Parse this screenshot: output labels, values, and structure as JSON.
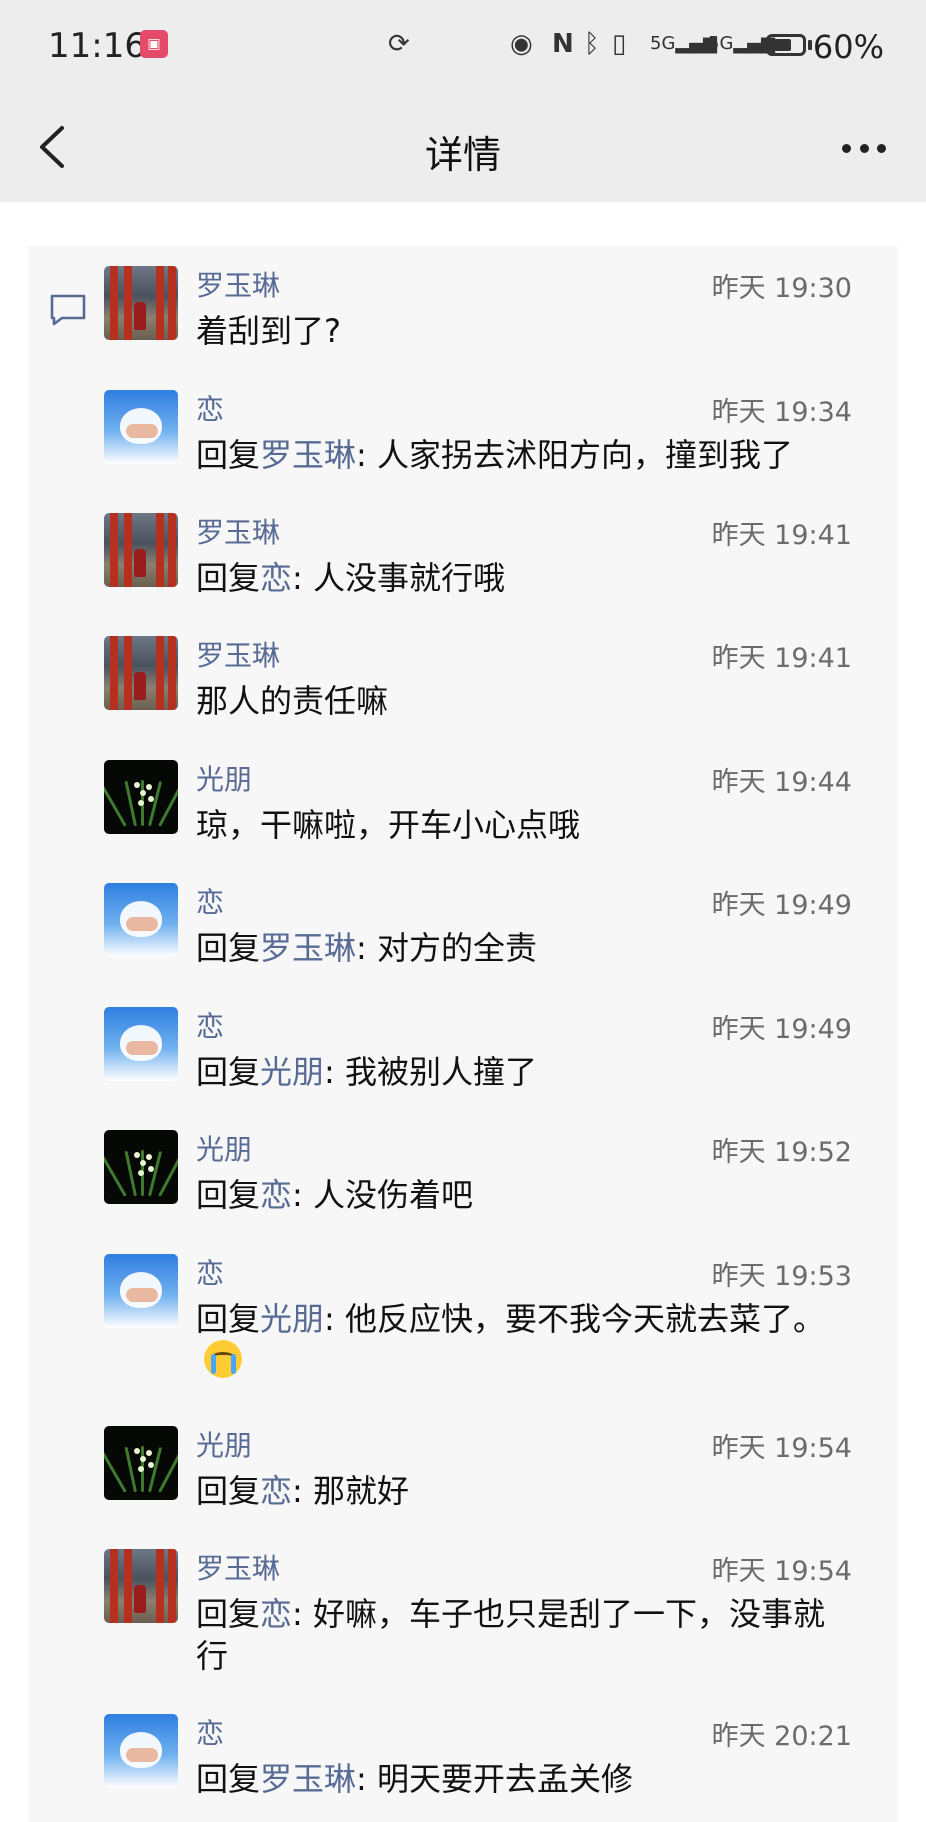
{
  "status_bar": {
    "time": "11:16",
    "battery": "60%",
    "icons": [
      "app-badge-icon",
      "sync-icon",
      "eye-icon",
      "nfc-icon",
      "bluetooth-icon",
      "vibrate-icon",
      "signal-5g-icon",
      "signal-5g-icon",
      "battery-icon"
    ]
  },
  "header": {
    "title": "详情"
  },
  "messages": [
    {
      "name": "罗玉琳",
      "time": "昨天 19:30",
      "avatar": "luo",
      "reply": false,
      "text": "着刮到了?"
    },
    {
      "name": "恋",
      "time": "昨天 19:34",
      "avatar": "lian",
      "reply": true,
      "reply_word": "回复",
      "target": "罗玉琳",
      "text": ": 人家拐去沭阳方向，撞到我了"
    },
    {
      "name": "罗玉琳",
      "time": "昨天 19:41",
      "avatar": "luo",
      "reply": true,
      "reply_word": "回复",
      "target": "恋",
      "text": ": 人没事就行哦"
    },
    {
      "name": "罗玉琳",
      "time": "昨天 19:41",
      "avatar": "luo",
      "reply": false,
      "text": "那人的责任嘛"
    },
    {
      "name": "光朋",
      "time": "昨天 19:44",
      "avatar": "guang",
      "reply": false,
      "text": "琼，干嘛啦，开车小心点哦"
    },
    {
      "name": "恋",
      "time": "昨天 19:49",
      "avatar": "lian",
      "reply": true,
      "reply_word": "回复",
      "target": "罗玉琳",
      "text": ": 对方的全责"
    },
    {
      "name": "恋",
      "time": "昨天 19:49",
      "avatar": "lian",
      "reply": true,
      "reply_word": "回复",
      "target": "光朋",
      "text": ": 我被别人撞了"
    },
    {
      "name": "光朋",
      "time": "昨天 19:52",
      "avatar": "guang",
      "reply": true,
      "reply_word": "回复",
      "target": "恋",
      "text": ": 人没伤着吧"
    },
    {
      "name": "恋",
      "time": "昨天 19:53",
      "avatar": "lian",
      "reply": true,
      "reply_word": "回复",
      "target": "光朋",
      "text": ": 他反应快，要不我今天就去菜了。",
      "emoji": "crying-face-icon"
    },
    {
      "name": "光朋",
      "time": "昨天 19:54",
      "avatar": "guang",
      "reply": true,
      "reply_word": "回复",
      "target": "恋",
      "text": ": 那就好"
    },
    {
      "name": "罗玉琳",
      "time": "昨天 19:54",
      "avatar": "luo",
      "reply": true,
      "reply_word": "回复",
      "target": "恋",
      "text": ": 好嘛，车子也只是刮了一下，没事就行"
    },
    {
      "name": "恋",
      "time": "昨天 20:21",
      "avatar": "lian",
      "reply": true,
      "reply_word": "回复",
      "target": "罗玉琳",
      "text": ": 明天要开去孟关修"
    }
  ]
}
